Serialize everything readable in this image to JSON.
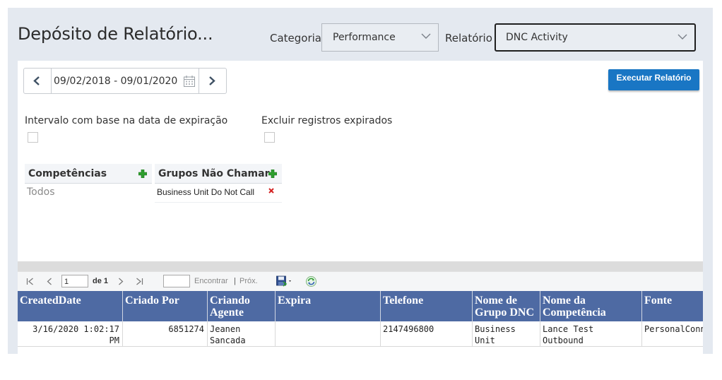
{
  "header": {
    "title": "Depósito de Relatório...",
    "category_label": "Categoria",
    "category_value": "Performance",
    "report_label": "Relatório",
    "report_value": "DNC Activity"
  },
  "filters": {
    "date_range": "09/02/2018 - 09/01/2020",
    "run_button": "Executar Relatório",
    "expiration_interval_label": "Intervalo com base na data de expiração",
    "exclude_expired_label": "Excluir registros expirados"
  },
  "grids": {
    "skills": {
      "header": "Competências",
      "value": "Todos"
    },
    "dnc_groups": {
      "header": "Grupos Não Chamar",
      "value": "Business Unit Do Not Call"
    }
  },
  "toolbar": {
    "page_value": "1",
    "of_label": "de 1",
    "find_label": "Encontrar",
    "separator": "|",
    "next_label": "Próx."
  },
  "report": {
    "columns": [
      "CreatedDate",
      "Criado Por",
      "Criando\nAgente",
      "Expira",
      "Telefone",
      "Nome de\nGrupo DNC",
      "Nome da\nCompetência",
      "Fonte"
    ],
    "rows": [
      [
        "3/16/2020 1:02:17 PM",
        "6851274",
        "Jeanen\nSancada",
        "",
        "2147496800",
        "Business Unit\nDo Not Call",
        "Lance Test Outbound",
        "PersonalConnection"
      ]
    ]
  },
  "colors": {
    "header_blue": "#4e6aa3",
    "button_blue": "#1976c4",
    "plus_green": "#2e9e2e",
    "remove_red": "#d32020"
  }
}
